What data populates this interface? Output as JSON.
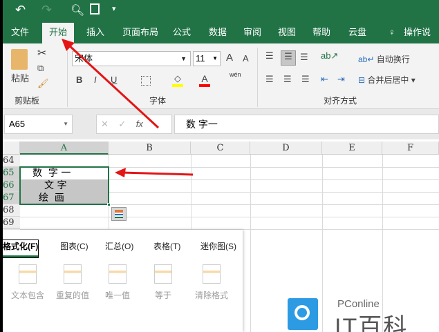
{
  "qat": {
    "icons": [
      "undo-icon",
      "redo-icon",
      "print-preview-icon",
      "save-icon",
      "customize-icon"
    ]
  },
  "tabs": [
    "文件",
    "开始",
    "插入",
    "页面布局",
    "公式",
    "数据",
    "审阅",
    "视图",
    "帮助",
    "云盘",
    "操作说明搜索"
  ],
  "ribbon": {
    "paste": "粘贴",
    "clipboard": "剪贴板",
    "font_name": "宋体",
    "font_size": "11",
    "font": "字体",
    "wrap_text": "自动换行",
    "merge_center": "合并后居中",
    "alignment": "对齐方式",
    "bold": "B",
    "italic": "I",
    "underline": "U",
    "font_color": "A",
    "grow": "A",
    "shrink": "A",
    "phonetic": "wén",
    "colors": {
      "highlight": "#ffff00",
      "font": "#ff0000"
    }
  },
  "formula_bar": {
    "name_box": "A65",
    "fx": "fx",
    "value": "数 字一"
  },
  "grid": {
    "columns": [
      "A",
      "B",
      "C",
      "D",
      "E",
      "F"
    ],
    "rows": [
      "64",
      "65",
      "66",
      "67",
      "68",
      "69"
    ],
    "cells": {
      "A65": "数  字 一",
      "A66": "文 字",
      "A67": "绘  画"
    }
  },
  "quick_analysis": {
    "tabs": [
      "格式化(F)",
      "图表(C)",
      "汇总(O)",
      "表格(T)",
      "迷你图(S)"
    ],
    "items": [
      "文本包含",
      "重复的值",
      "唯一值",
      "等于",
      "清除格式"
    ]
  },
  "watermark": {
    "brand": "PConline",
    "name": "IT百科"
  },
  "accent": "#217346"
}
